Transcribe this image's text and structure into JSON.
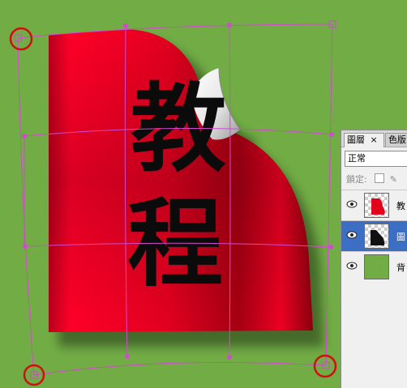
{
  "canvas": {
    "background_color": "#71ac45",
    "paper_color": "#e8001e",
    "paper_text": [
      "教",
      "程"
    ]
  },
  "transform": {
    "guide_color": "#d34ad0",
    "marker_color": "#d01010"
  },
  "layers_panel": {
    "tabs": [
      {
        "label": "圖層",
        "close": "×",
        "active": true
      },
      {
        "label": "色版",
        "active": false
      }
    ],
    "blend_mode": "正常",
    "lock_label": "鎖定:",
    "layers": [
      {
        "name": "教",
        "thumb": "text-thumbnail",
        "selected": false
      },
      {
        "name": "圖",
        "thumb": "shape-thumbnail",
        "selected": true
      },
      {
        "name": "背",
        "thumb": "background-thumbnail",
        "selected": false
      }
    ]
  }
}
